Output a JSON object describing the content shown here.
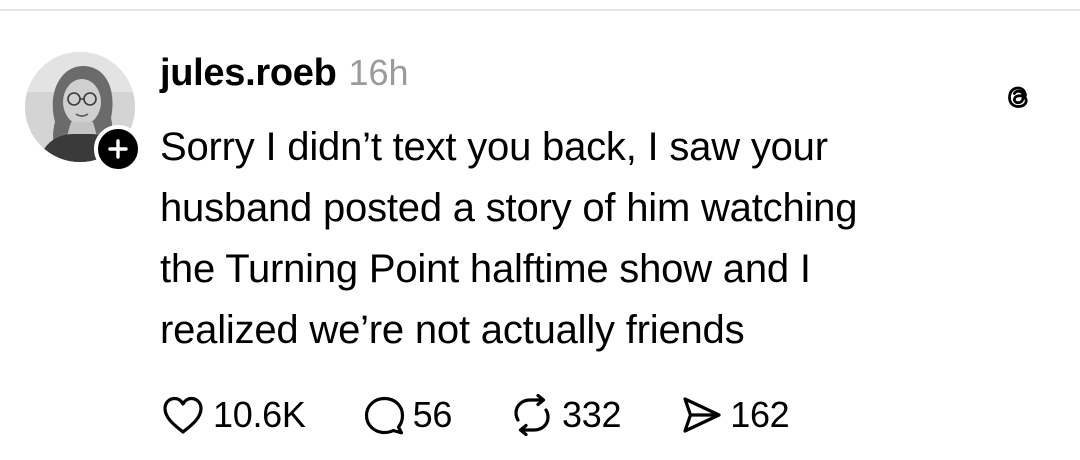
{
  "post": {
    "username": "jules.roeb",
    "timestamp": "16h",
    "text_lines": [
      "Sorry I didn’t text you back, I saw your",
      "husband posted a story of him watching",
      "the Turning Point halftime show and I",
      "realized we’re not actually friends"
    ],
    "stats": {
      "likes": "10.6K",
      "replies": "56",
      "reposts": "332",
      "shares": "162"
    }
  },
  "icons": {
    "avatar": "avatar",
    "follow": "plus-icon",
    "app": "threads-logo-icon",
    "like": "heart-icon",
    "reply": "comment-icon",
    "repost": "repost-icon",
    "share": "send-icon"
  },
  "colors": {
    "text": "#000000",
    "muted": "#9a9a9a",
    "badge": "#000000"
  }
}
